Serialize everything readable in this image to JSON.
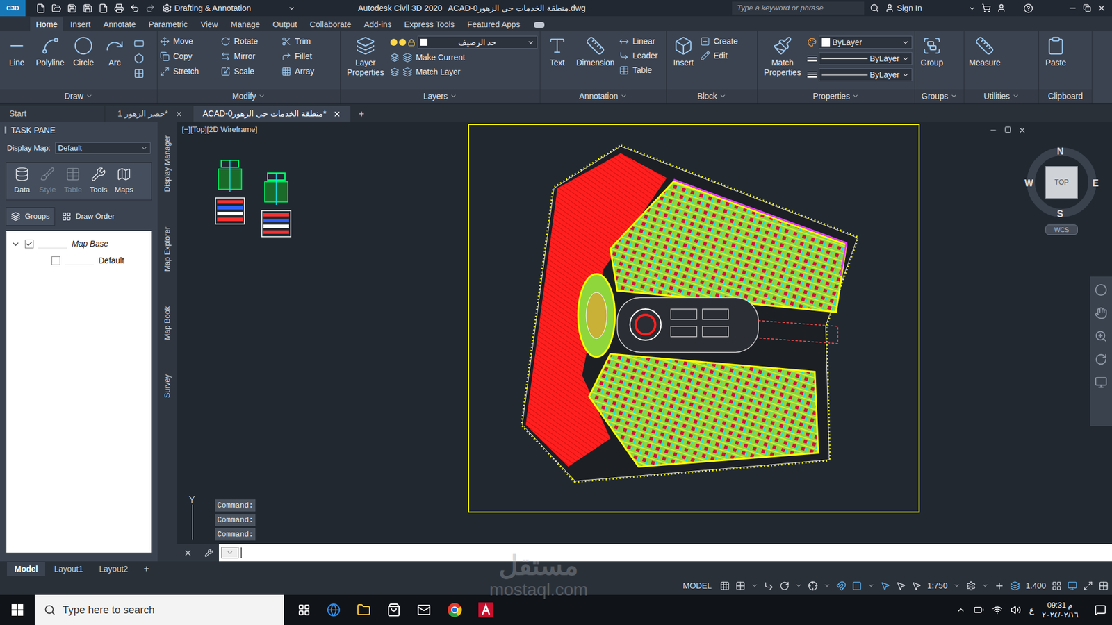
{
  "titlebar": {
    "logo": "C3D",
    "workspace": "Drafting & Annotation",
    "app": "Autodesk Civil 3D 2020",
    "file": "ACAD-منطقة الخدمات حي الزهور0.dwg",
    "search_placeholder": "Type a keyword or phrase",
    "sign_in": "Sign In"
  },
  "ribbon_tabs": [
    {
      "label": "Home",
      "selected": true
    },
    {
      "label": "Insert",
      "selected": false
    },
    {
      "label": "Annotate",
      "selected": false
    },
    {
      "label": "Parametric",
      "selected": false
    },
    {
      "label": "View",
      "selected": false
    },
    {
      "label": "Manage",
      "selected": false
    },
    {
      "label": "Output",
      "selected": false
    },
    {
      "label": "Collaborate",
      "selected": false
    },
    {
      "label": "Add-ins",
      "selected": false
    },
    {
      "label": "Express Tools",
      "selected": false
    },
    {
      "label": "Featured Apps",
      "selected": false
    }
  ],
  "ribbon_panels": [
    {
      "title": "Draw",
      "expandable": true,
      "large": [
        "Line",
        "Polyline",
        "Circle",
        "Arc"
      ],
      "dropdowns": [],
      "small": []
    },
    {
      "title": "Modify",
      "expandable": true,
      "large": [],
      "dropdowns": [],
      "small": [
        "Move",
        "Rotate",
        "Trim",
        "Copy",
        "Mirror",
        "Fillet",
        "Stretch",
        "Scale",
        "Array"
      ]
    },
    {
      "title": "Layers",
      "expandable": true,
      "large": [
        "Layer Properties"
      ],
      "dropdowns": [
        "حد الرصيف"
      ],
      "small": [
        "Make Current",
        "Match Layer"
      ]
    },
    {
      "title": "Annotation",
      "expandable": true,
      "large": [
        "Text",
        "Dimension"
      ],
      "dropdowns": [],
      "small": [
        "Linear",
        "Leader",
        "Table"
      ]
    },
    {
      "title": "Block",
      "expandable": true,
      "large": [
        "Insert"
      ],
      "dropdowns": [],
      "small": [
        "Create",
        "Edit"
      ]
    },
    {
      "title": "Properties",
      "expandable": true,
      "large": [
        "Match Properties"
      ],
      "dropdowns": [
        "ByLayer",
        "ByLayer",
        "ByLayer"
      ],
      "small": []
    },
    {
      "title": "Groups",
      "expandable": true,
      "large": [
        "Group"
      ],
      "dropdowns": [],
      "small": []
    },
    {
      "title": "Utilities",
      "expandable": true,
      "large": [
        "Measure"
      ],
      "dropdowns": [],
      "small": []
    },
    {
      "title": "Clipboard",
      "expandable": false,
      "large": [
        "Paste"
      ],
      "dropdowns": [],
      "small": []
    }
  ],
  "file_tabs": [
    {
      "label": "Start",
      "selected": false,
      "closable": false
    },
    {
      "label": "حصر الزهور 1*",
      "selected": false,
      "closable": true
    },
    {
      "label": "ACAD-منطقة الخدمات حي الزهور0*",
      "selected": true,
      "closable": true
    }
  ],
  "new_tab": "+",
  "task_pane": {
    "title": "TASK PANE",
    "display_map_label": "Display Map:",
    "display_map_value": "Default",
    "tools": [
      {
        "label": "Data",
        "disabled": false
      },
      {
        "label": "Style",
        "disabled": true
      },
      {
        "label": "Table",
        "disabled": true
      },
      {
        "label": "Tools",
        "disabled": false
      },
      {
        "label": "Maps",
        "disabled": false
      }
    ],
    "tabs": [
      "Groups",
      "Draw Order"
    ],
    "tree": [
      {
        "label": "Map Base",
        "checked": true,
        "expanded": true,
        "level": 0
      },
      {
        "label": "Default",
        "checked": false,
        "expanded": false,
        "level": 1
      }
    ]
  },
  "side_tabs": [
    "Display Manager",
    "Map Explorer",
    "Map Book",
    "Survey"
  ],
  "viewport": {
    "label": "[−][Top][2D Wireframe]",
    "ucs_axis": "Y"
  },
  "viewcube": {
    "north": "N",
    "south": "S",
    "east": "E",
    "west": "W",
    "face": "TOP",
    "ucs": "WCS"
  },
  "command": {
    "history": [
      "Command:",
      "Command:",
      "Command:"
    ]
  },
  "layout_tabs": [
    {
      "label": "Model",
      "selected": true
    },
    {
      "label": "Layout1",
      "selected": false
    },
    {
      "label": "Layout2",
      "selected": false
    }
  ],
  "layout_add": "+",
  "status_bar": {
    "mode": "MODEL",
    "scale": "1:750",
    "value": "1.400"
  },
  "taskbar": {
    "search_placeholder": "Type here to search",
    "time": "09:31 م",
    "date": "٢٠٢٤/٠٢/١٦",
    "language": "ع"
  },
  "watermark": {
    "arabic": "مستقل",
    "latin": "mostaql.com"
  }
}
